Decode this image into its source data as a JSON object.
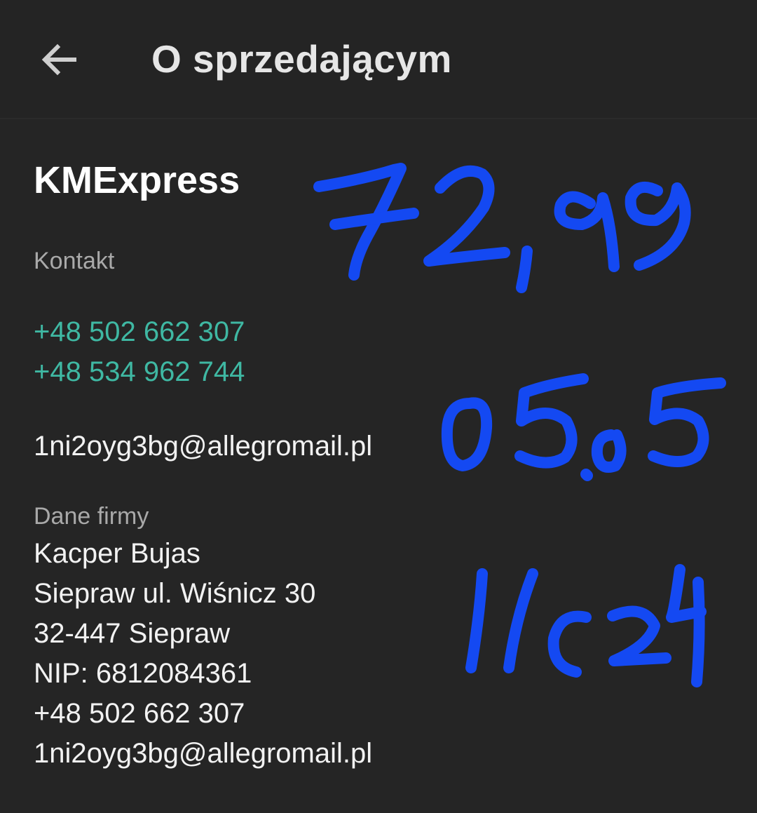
{
  "appbar": {
    "title": "O sprzedającym",
    "back_icon": "arrow-left-icon"
  },
  "seller": {
    "name": "KMExpress"
  },
  "contact": {
    "label": "Kontakt",
    "phones": [
      "+48 502 662 307",
      "+48 534 962 744"
    ],
    "email": "1ni2oyg3bg@allegromail.pl"
  },
  "company": {
    "label": "Dane firmy",
    "lines": [
      "Kacper Bujas",
      "Siepraw ul. Wiśnicz 30",
      "32-447 Siepraw",
      "NIP: 6812084361",
      "+48 502 662 307",
      "1ni2oyg3bg@allegromail.pl"
    ]
  },
  "colors": {
    "background": "#252525",
    "link": "#3fb8a3",
    "handwriting": "#1449f2"
  },
  "handwritten_notes": [
    "72,99",
    "05.05",
    "1124"
  ]
}
